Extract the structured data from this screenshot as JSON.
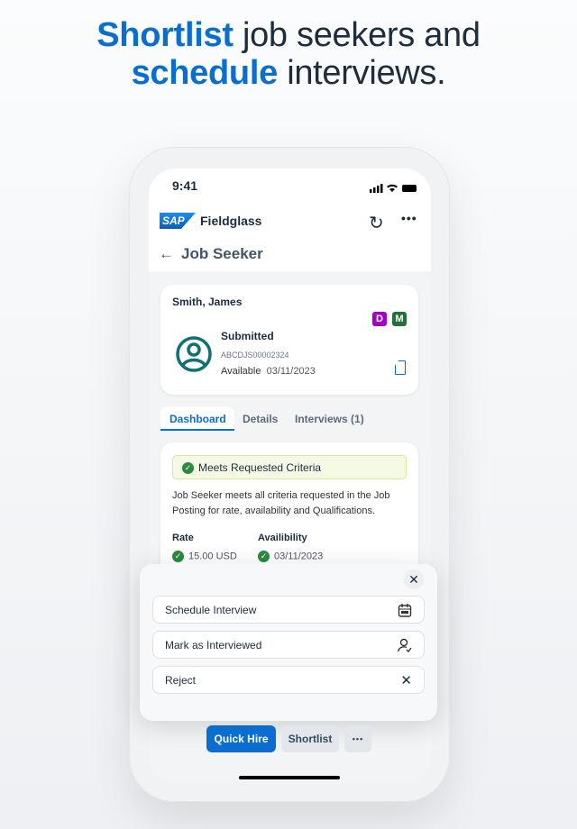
{
  "headline": {
    "line1_accent": "Shortlist",
    "line1_rest": " job seekers and",
    "line2_accent": "schedule",
    "line2_rest": " interviews."
  },
  "status_bar": {
    "time": "9:41"
  },
  "app": {
    "logo": "SAP",
    "title": "Fieldglass",
    "refresh_icon": "refresh-icon",
    "more_icon": "more-icon"
  },
  "page": {
    "back_icon": "arrow-left-icon",
    "title": "Job Seeker"
  },
  "candidate": {
    "name": "Smith, James",
    "badges": [
      {
        "label": "D",
        "color": "#a100c2"
      },
      {
        "label": "M",
        "color": "#256f3a"
      }
    ],
    "status": "Submitted",
    "id": "ABCDJS00002324",
    "available_label": "Available",
    "available_date": "03/11/2023"
  },
  "tabs": [
    {
      "label": "Dashboard",
      "active": true
    },
    {
      "label": "Details"
    },
    {
      "label": "Interviews (1)"
    }
  ],
  "dashboard": {
    "criteria_banner": "Meets Requested Criteria",
    "description": "Job Seeker meets all criteria requested in the Job Posting for rate, availability and Qualifications.",
    "rate_label": "Rate",
    "rate_value": "15.00 USD",
    "availability_label": "Availibility",
    "availability_value": "03/11/2023"
  },
  "action_sheet": {
    "items": [
      {
        "label": "Schedule Interview",
        "icon": "calendar-icon"
      },
      {
        "label": "Mark as Interviewed",
        "icon": "person-check-icon"
      },
      {
        "label": "Reject",
        "icon": "close-icon"
      }
    ]
  },
  "footer": {
    "quick_hire": "Quick Hire",
    "shortlist": "Shortlist"
  },
  "colors": {
    "accent": "#0a6ed1",
    "success": "#2b8a3e",
    "avatar": "#0f7173"
  }
}
